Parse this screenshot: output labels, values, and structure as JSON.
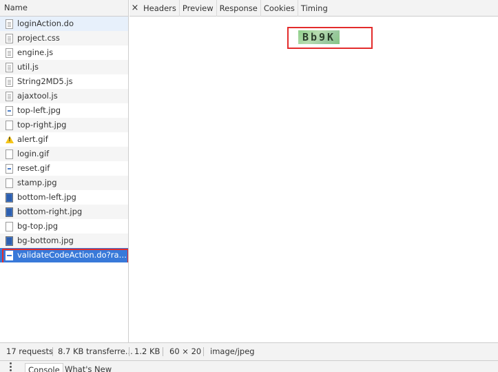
{
  "network_list": {
    "column_header": "Name",
    "requests": [
      {
        "name": "loginAction.do",
        "icon": "document-icon"
      },
      {
        "name": "project.css",
        "icon": "document-icon"
      },
      {
        "name": "engine.js",
        "icon": "document-icon"
      },
      {
        "name": "util.js",
        "icon": "document-icon"
      },
      {
        "name": "String2MD5.js",
        "icon": "document-icon"
      },
      {
        "name": "ajaxtool.js",
        "icon": "document-icon"
      },
      {
        "name": "top-left.jpg",
        "icon": "image-icon"
      },
      {
        "name": "top-right.jpg",
        "icon": "document-icon"
      },
      {
        "name": "alert.gif",
        "icon": "warning-icon"
      },
      {
        "name": "login.gif",
        "icon": "document-icon"
      },
      {
        "name": "reset.gif",
        "icon": "image-icon"
      },
      {
        "name": "stamp.jpg",
        "icon": "document-icon"
      },
      {
        "name": "bottom-left.jpg",
        "icon": "image-icon"
      },
      {
        "name": "bottom-right.jpg",
        "icon": "image-icon"
      },
      {
        "name": "bg-top.jpg",
        "icon": "document-icon"
      },
      {
        "name": "bg-bottom.jpg",
        "icon": "image-icon"
      },
      {
        "name": "validateCodeAction.do?ran...",
        "icon": "image-icon",
        "selected": true
      }
    ]
  },
  "detail": {
    "close_icon": "close-icon",
    "tabs": [
      "Headers",
      "Preview",
      "Response",
      "Cookies",
      "Timing"
    ],
    "captcha_text": "Bb9K"
  },
  "status": {
    "requests": "17 requests",
    "transferred": "8.7 KB transferre...",
    "size": "1.2 KB",
    "dimensions": "60 × 20",
    "mime": "image/jpeg"
  },
  "drawer": {
    "tabs": [
      "Console",
      "What's New"
    ]
  },
  "colors": {
    "selection": "#3879d9",
    "highlight_box": "#e32b2b"
  }
}
